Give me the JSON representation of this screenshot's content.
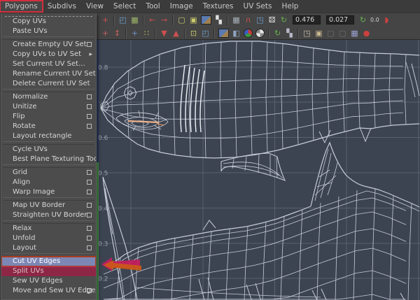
{
  "menubar": {
    "items": [
      {
        "label": "Polygons",
        "highlighted": true
      },
      {
        "label": "Subdivs"
      },
      {
        "label": "View"
      },
      {
        "label": "Select"
      },
      {
        "label": "Tool"
      },
      {
        "label": "Image"
      },
      {
        "label": "Textures"
      },
      {
        "label": "UV Sets"
      },
      {
        "label": "Help"
      }
    ]
  },
  "menu": {
    "items": [
      {
        "label": "Copy UVs"
      },
      {
        "label": "Paste UVs"
      },
      {
        "type": "separator"
      },
      {
        "label": "Create Empty UV Set",
        "option_box": true
      },
      {
        "label": "Copy UVs to UV Set",
        "submenu": true
      },
      {
        "label": "Set Current UV Set..."
      },
      {
        "label": "Rename Current UV Set..."
      },
      {
        "label": "Delete Current UV Set"
      },
      {
        "type": "separator"
      },
      {
        "label": "Normalize",
        "option_box": true
      },
      {
        "label": "Unitize",
        "option_box": true
      },
      {
        "label": "Flip",
        "option_box": true
      },
      {
        "label": "Rotate",
        "option_box": true
      },
      {
        "label": "Layout rectangle"
      },
      {
        "type": "separator"
      },
      {
        "label": "Cycle UVs"
      },
      {
        "label": "Best Plane Texturing Tool"
      },
      {
        "type": "separator"
      },
      {
        "label": "Grid",
        "option_box": true
      },
      {
        "label": "Align",
        "option_box": true
      },
      {
        "label": "Warp Image",
        "option_box": true
      },
      {
        "type": "separator"
      },
      {
        "label": "Map UV Border",
        "option_box": true
      },
      {
        "label": "Straighten UV Border",
        "option_box": true
      },
      {
        "type": "separator"
      },
      {
        "label": "Relax",
        "option_box": true
      },
      {
        "label": "Unfold",
        "option_box": true
      },
      {
        "label": "Layout",
        "option_box": true
      },
      {
        "type": "separator"
      },
      {
        "label": "Cut UV Edges",
        "highlighted": true,
        "annotation": "red-box"
      },
      {
        "label": "Split UVs",
        "annotation": "red-fill"
      },
      {
        "label": "Sew UV Edges"
      },
      {
        "label": "Move and Sew UV Edges",
        "option_box": true
      }
    ]
  },
  "toolbar": {
    "u_value": "0.476",
    "v_value": "0.027",
    "zero_label": "0.0",
    "row1": [
      {
        "t": "icon",
        "name": "uv-lattice-cut-icon",
        "glyph": "+",
        "color": "#cf5050"
      },
      {
        "t": "sep"
      },
      {
        "t": "icon",
        "name": "flip-shell-icon",
        "glyph": "◰",
        "color": "#6fa3d8"
      },
      {
        "t": "icon",
        "name": "uv-grid-icon",
        "glyph": "▦",
        "color": "#9fb86a"
      },
      {
        "t": "sep"
      },
      {
        "t": "icon",
        "name": "align-left-icon",
        "glyph": "←",
        "color": "#cf5050"
      },
      {
        "t": "icon",
        "name": "align-right-icon",
        "glyph": "→",
        "color": "#cf5050"
      },
      {
        "t": "sep"
      },
      {
        "t": "icon",
        "name": "marquee-select-icon",
        "glyph": "▢",
        "color": "#c9c96a"
      },
      {
        "t": "icon",
        "name": "marquee-target-icon",
        "glyph": "▣",
        "color": "#c9c96a"
      },
      {
        "t": "thumb",
        "name": "image-display-icon"
      },
      {
        "t": "icon",
        "name": "checker-dots-icon",
        "glyph": "▚",
        "color": "#e0e0e0"
      },
      {
        "t": "sep"
      },
      {
        "t": "icon",
        "name": "pixel-snap-icon",
        "glyph": "▦",
        "color": "#aab2ba"
      },
      {
        "t": "icon",
        "name": "magnet-snap-icon",
        "glyph": "∩",
        "color": "#d05050"
      },
      {
        "t": "icon",
        "name": "layered-shells-icon",
        "glyph": "◳",
        "color": "#6fa3d8"
      },
      {
        "t": "icon",
        "name": "dice-texel-icon",
        "glyph": "⚄",
        "color": "#e8e8e8"
      },
      {
        "t": "icon",
        "name": "refresh-ratio-icon",
        "glyph": "↻",
        "color": "#66b04e"
      },
      {
        "t": "field",
        "name": "u-coord-field",
        "bind": "toolbar.u_value"
      },
      {
        "t": "field",
        "name": "v-coord-field",
        "bind": "toolbar.v_value"
      },
      {
        "t": "icon",
        "name": "refresh-zero-icon",
        "glyph": "↻",
        "color": "#66b04e"
      },
      {
        "t": "label",
        "name": "zero-value-label",
        "bind": "toolbar.zero_label"
      },
      {
        "t": "icon",
        "name": "partial-red-icon",
        "glyph": "◗",
        "color": "#cc4040"
      }
    ],
    "row2": [
      {
        "t": "icon",
        "name": "axis-manip-icon",
        "glyph": "+",
        "color": "#c96060"
      },
      {
        "t": "icon",
        "name": "move-vertical-icon",
        "glyph": "↕",
        "color": "#c96060"
      },
      {
        "t": "sep"
      },
      {
        "t": "icon",
        "name": "add-shell-icon",
        "glyph": "+",
        "color": "#6b93cc"
      },
      {
        "t": "icon",
        "name": "select-dots-icon",
        "glyph": "∷",
        "color": "#c9c96a"
      },
      {
        "t": "sep"
      },
      {
        "t": "icon",
        "name": "pin-down-icon",
        "glyph": "▼",
        "color": "#cf5050"
      },
      {
        "t": "icon",
        "name": "pin-up-icon",
        "glyph": "▲",
        "color": "#cf5050"
      },
      {
        "t": "sep"
      },
      {
        "t": "icon",
        "name": "lattice-points-icon",
        "glyph": "⊡",
        "color": "#c9c96a"
      },
      {
        "t": "icon",
        "name": "frame-uv-icon",
        "glyph": "◰",
        "color": "#6fa3d8"
      },
      {
        "t": "sep"
      },
      {
        "t": "thumb",
        "name": "image-range-icon"
      },
      {
        "t": "icon",
        "name": "overlap-shells-icon",
        "glyph": "◧",
        "color": "#8fa3c0"
      },
      {
        "t": "circle",
        "name": "rgb-channels-icon",
        "bg": "conic-gradient(#c43c3c 0 33%,#3c9c3c 33% 66%,#3c5cc4 66% 100%)"
      },
      {
        "t": "circle",
        "name": "alpha-channel-icon",
        "bg": "conic-gradient(#e8e8e8 0 25%,#888 25% 50%,#e8e8e8 50% 75%,#888 75% 100%)"
      },
      {
        "t": "sep"
      },
      {
        "t": "icon",
        "name": "refresh-checker-icon",
        "glyph": "↻",
        "color": "#66b04e"
      },
      {
        "t": "icon",
        "name": "checker-ghost-icon",
        "glyph": "▚",
        "color": "#b8b8c8"
      },
      {
        "t": "sep"
      },
      {
        "t": "icon",
        "name": "copy-uv-icon",
        "glyph": "◳",
        "color": "#c9c0a8"
      },
      {
        "t": "icon",
        "name": "paste-uv-icon",
        "glyph": "▣",
        "color": "#c9b890"
      },
      {
        "t": "icon",
        "name": "paste-u-disabled-icon",
        "glyph": "▢",
        "color": "#6f6f6f"
      },
      {
        "t": "icon",
        "name": "paste-v-disabled-icon",
        "glyph": "▢",
        "color": "#6f6f6f"
      },
      {
        "t": "icon",
        "name": "cycle-shell-icon",
        "glyph": "▦",
        "color": "#9aa0d0"
      },
      {
        "t": "icon",
        "name": "red-dot-icon",
        "glyph": "●",
        "color": "#cc4040"
      }
    ]
  },
  "viewport": {
    "axis_labels": [
      "0.8",
      "0.6",
      "0.5",
      "0.4",
      "0.3",
      "0.2"
    ],
    "colors": {
      "background": "#3c4452",
      "grid": "#59616e",
      "wireframe": "#c6ccd6",
      "gills": "#eef2f7",
      "selected_edge": "#ecb28c",
      "axis_green": "#4d8f4d",
      "axis_navy": "#2c3a5e",
      "label": "#99a1ab"
    },
    "content": "UV wireframe of shark mesh shells"
  },
  "annotations": {
    "polygons_box_color": "#d32f3f",
    "cut_uv_edges_box_color": "#a93b1e",
    "split_uvs_fill_color": "#8e2746",
    "arrow_primary": "#c21f5e",
    "arrow_secondary": "#cc5a17"
  }
}
